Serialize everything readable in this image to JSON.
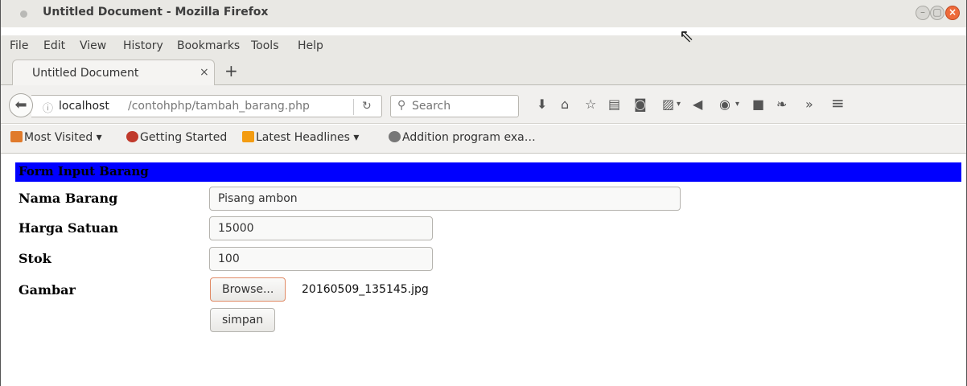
{
  "window": {
    "title": "Untitled Document - Mozilla Firefox",
    "controls": {
      "minimize": "–",
      "maximize": "▢",
      "close": "×"
    }
  },
  "menu": [
    "File",
    "Edit",
    "View",
    "History",
    "Bookmarks",
    "Tools",
    "Help"
  ],
  "tabs": [
    {
      "label": "Untitled Document",
      "close": "×",
      "active": true
    }
  ],
  "new_tab": "+",
  "nav": {
    "back_icon": "back-arrow-icon",
    "url_host": "localhost",
    "url_path": "/contohphp/tambah_barang.php",
    "reload_icon": "reload-icon",
    "search_placeholder": "Search",
    "overflow": "»",
    "menu": "≡"
  },
  "bookmarks": [
    {
      "label": "Most Visited ▾",
      "icon": "folder-icon",
      "color": "#e07a2b"
    },
    {
      "label": "Getting Started",
      "icon": "firefox-icon",
      "color": "#c0392b"
    },
    {
      "label": "Latest Headlines ▾",
      "icon": "rss-icon",
      "color": "#f39c12"
    },
    {
      "label": "Addition program exa…",
      "icon": "globe-icon",
      "color": "#777777"
    }
  ],
  "form": {
    "header": "Form Input Barang",
    "header_color": "#0000ff",
    "fields": {
      "nama_label": "Nama Barang",
      "nama_value": "Pisang ambon",
      "harga_label": "Harga Satuan",
      "harga_value": "15000",
      "stok_label": "Stok",
      "stok_value": "100",
      "gambar_label": "Gambar",
      "browse_label": "Browse...",
      "file_name": "20160509_135145.jpg"
    },
    "submit_label": "simpan"
  }
}
